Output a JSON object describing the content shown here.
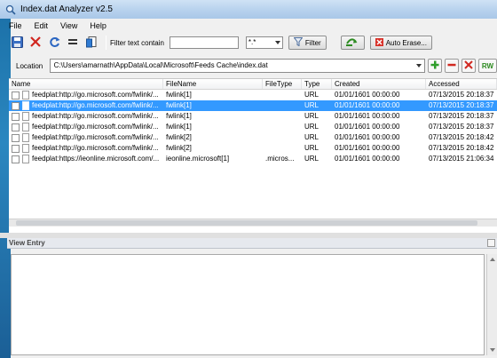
{
  "window": {
    "title": "Index.dat Analyzer v2.5"
  },
  "menu": [
    "File",
    "Edit",
    "View",
    "Help"
  ],
  "toolbar": {
    "filter_label": "Filter text contain",
    "filter_value": "",
    "pattern_value": "*.*",
    "filter_button": "Filter",
    "auto_erase_button": "Auto Erase..."
  },
  "location": {
    "label": "Location",
    "path": "C:\\Users\\amarnath\\AppData\\Local\\Microsoft\\Feeds Cache\\index.dat",
    "rw_label": "RW"
  },
  "table": {
    "columns": [
      "Name",
      "FileName",
      "FileType",
      "Type",
      "Created",
      "Accessed"
    ],
    "rows": [
      {
        "name": "feedplat:http://go.microsoft.com/fwlink/...",
        "filename": "fwlink[1]",
        "filetype": "",
        "type": "URL",
        "created": "01/01/1601   00:00:00",
        "accessed": "07/13/2015   20:18:37",
        "selected": false
      },
      {
        "name": "feedplat:http://go.microsoft.com/fwlink/...",
        "filename": "fwlink[1]",
        "filetype": "",
        "type": "URL",
        "created": "01/01/1601   00:00:00",
        "accessed": "07/13/2015   20:18:37",
        "selected": true
      },
      {
        "name": "feedplat:http://go.microsoft.com/fwlink/...",
        "filename": "fwlink[1]",
        "filetype": "",
        "type": "URL",
        "created": "01/01/1601   00:00:00",
        "accessed": "07/13/2015   20:18:37",
        "selected": false
      },
      {
        "name": "feedplat:http://go.microsoft.com/fwlink/...",
        "filename": "fwlink[1]",
        "filetype": "",
        "type": "URL",
        "created": "01/01/1601   00:00:00",
        "accessed": "07/13/2015   20:18:37",
        "selected": false
      },
      {
        "name": "feedplat:http://go.microsoft.com/fwlink/...",
        "filename": "fwlink[2]",
        "filetype": "",
        "type": "URL",
        "created": "01/01/1601   00:00:00",
        "accessed": "07/13/2015   20:18:42",
        "selected": false
      },
      {
        "name": "feedplat:http://go.microsoft.com/fwlink/...",
        "filename": "fwlink[2]",
        "filetype": "",
        "type": "URL",
        "created": "01/01/1601   00:00:00",
        "accessed": "07/13/2015   20:18:42",
        "selected": false
      },
      {
        "name": "feedplat:https://ieonline.microsoft.com/...",
        "filename": "ieonline.microsoft[1]",
        "filetype": ".micros...",
        "type": "URL",
        "created": "01/01/1601   00:00:00",
        "accessed": "07/13/2015   21:06:34",
        "selected": false
      }
    ]
  },
  "view_entry": {
    "title": "View Entry",
    "content": ""
  },
  "colors": {
    "selection": "#3399ff",
    "titlebar": "#b9d3ee",
    "desktop": "#1a6fa6"
  }
}
